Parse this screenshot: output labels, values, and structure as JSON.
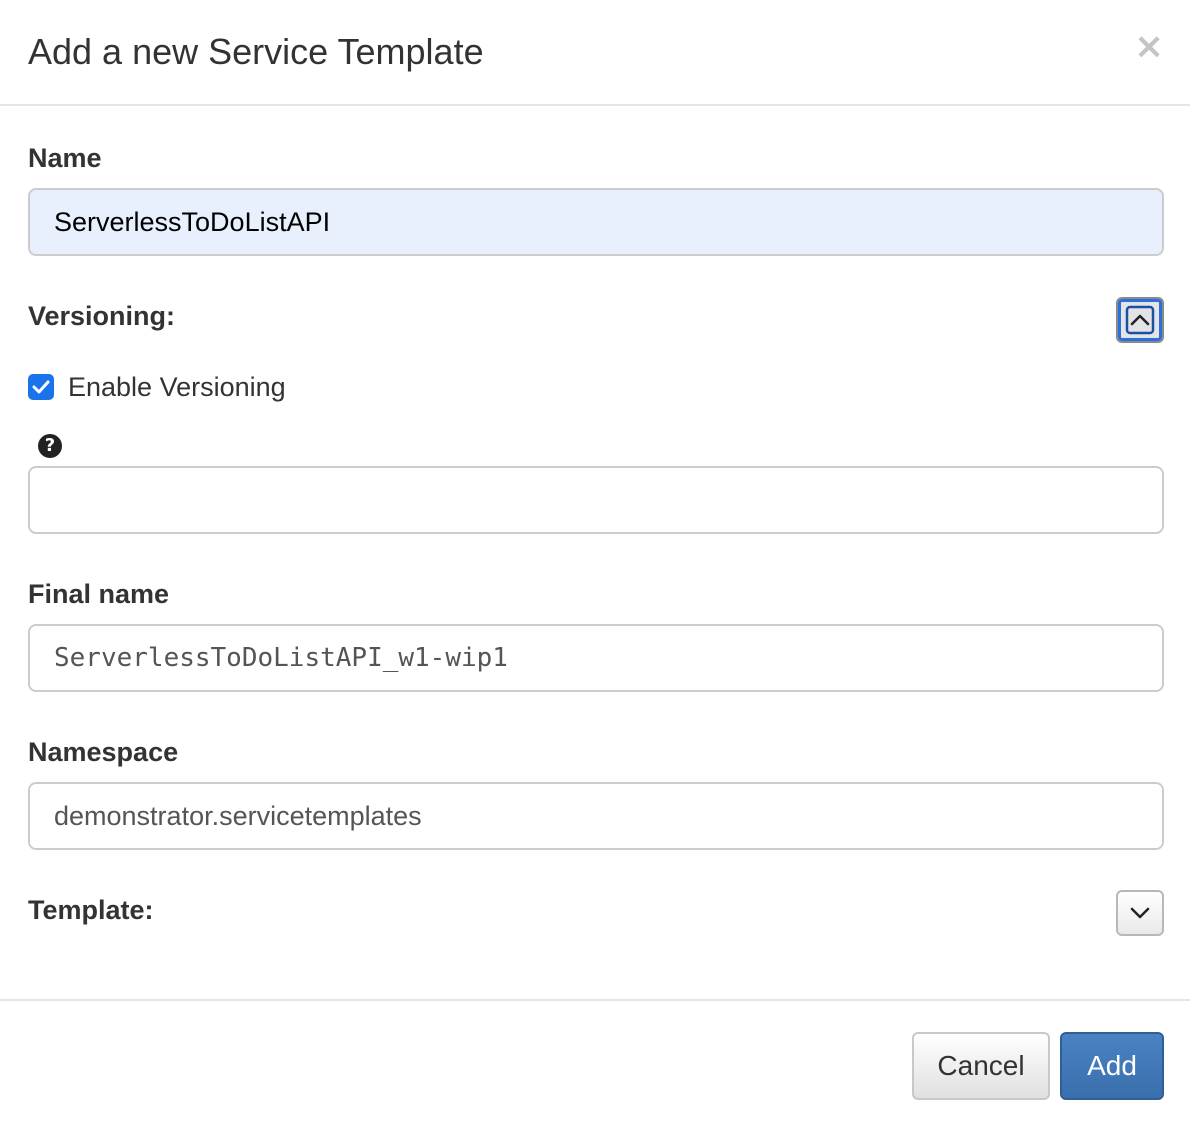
{
  "dialog": {
    "title": "Add a new Service Template",
    "close_label": "×"
  },
  "name": {
    "label": "Name",
    "value": "ServerlessToDoListAPI"
  },
  "versioning": {
    "label": "Versioning:",
    "toggle_icon": "chevron-up-icon",
    "enable_label": "Enable Versioning",
    "enabled": true,
    "help_icon": "question-circle-icon",
    "help_glyph": "?",
    "version_value": ""
  },
  "final_name": {
    "label": "Final name",
    "value": "ServerlessToDoListAPI_w1-wip1"
  },
  "namespace": {
    "label": "Namespace",
    "value": "demonstrator.servicetemplates"
  },
  "template": {
    "label": "Template:",
    "toggle_icon": "chevron-down-icon"
  },
  "footer": {
    "cancel_label": "Cancel",
    "add_label": "Add"
  },
  "colors": {
    "primary": "#3a6fad",
    "checkbox": "#1a73e8",
    "autofill_bg": "#e8f0fe"
  }
}
